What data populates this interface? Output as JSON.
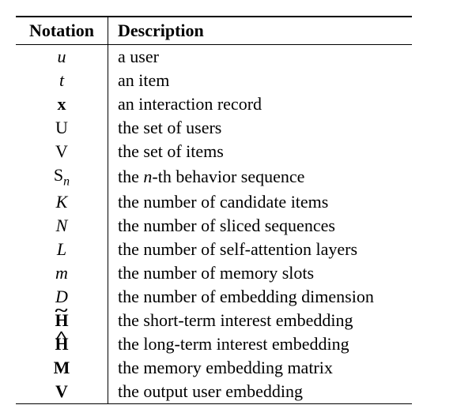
{
  "headers": {
    "notation": "Notation",
    "description": "Description"
  },
  "rows": [
    {
      "notation_html": "<span class='math-var'>u</span>",
      "description": "a user"
    },
    {
      "notation_html": "<span class='math-var'>t</span>",
      "description": "an item"
    },
    {
      "notation_html": "<span class='bold'>x</span>",
      "description": "an interaction record"
    },
    {
      "notation_html": "<span class='cal'>U</span>",
      "description": "the set of users"
    },
    {
      "notation_html": "<span class='cal'>V</span>",
      "description": "the set of items"
    },
    {
      "notation_html": "<span class='cal'>S</span><span class='sub'>n</span>",
      "description_html": "the <span class='math-var'>n</span>-th behavior sequence"
    },
    {
      "notation_html": "<span class='math-var'>K</span>",
      "description": "the number of candidate items"
    },
    {
      "notation_html": "<span class='math-var'>N</span>",
      "description": "the number of sliced sequences"
    },
    {
      "notation_html": "<span class='math-var'>L</span>",
      "description": "the number of self-attention layers"
    },
    {
      "notation_html": "<span class='math-var'>m</span>",
      "description": "the number of memory slots"
    },
    {
      "notation_html": "<span class='math-var'>D</span>",
      "description": "the number of embedding dimension"
    },
    {
      "notation_html": "<span class='tilde-wrap bold'>H</span>",
      "description": "the short-term interest embedding"
    },
    {
      "notation_html": "<span class='hat-wrap bold'>H</span>",
      "description": "the long-term interest embedding"
    },
    {
      "notation_html": "<span class='bold'>M</span>",
      "description": "the memory embedding matrix"
    },
    {
      "notation_html": "<span class='bold'>V</span>",
      "description": "the output user embedding"
    }
  ],
  "chart_data": {
    "type": "table",
    "title": "Notation table",
    "columns": [
      "Notation",
      "Description"
    ],
    "rows": [
      [
        "u",
        "a user"
      ],
      [
        "t",
        "an item"
      ],
      [
        "x (bold)",
        "an interaction record"
      ],
      [
        "U (caligraphic)",
        "the set of users"
      ],
      [
        "V (caligraphic)",
        "the set of items"
      ],
      [
        "S_n (caligraphic)",
        "the n-th behavior sequence"
      ],
      [
        "K",
        "the number of candidate items"
      ],
      [
        "N",
        "the number of sliced sequences"
      ],
      [
        "L",
        "the number of self-attention layers"
      ],
      [
        "m",
        "the number of memory slots"
      ],
      [
        "D",
        "the number of embedding dimension"
      ],
      [
        "H-tilde (bold)",
        "the short-term interest embedding"
      ],
      [
        "H-hat (bold)",
        "the long-term interest embedding"
      ],
      [
        "M (bold)",
        "the memory embedding matrix"
      ],
      [
        "V (bold)",
        "the output user embedding"
      ]
    ]
  }
}
